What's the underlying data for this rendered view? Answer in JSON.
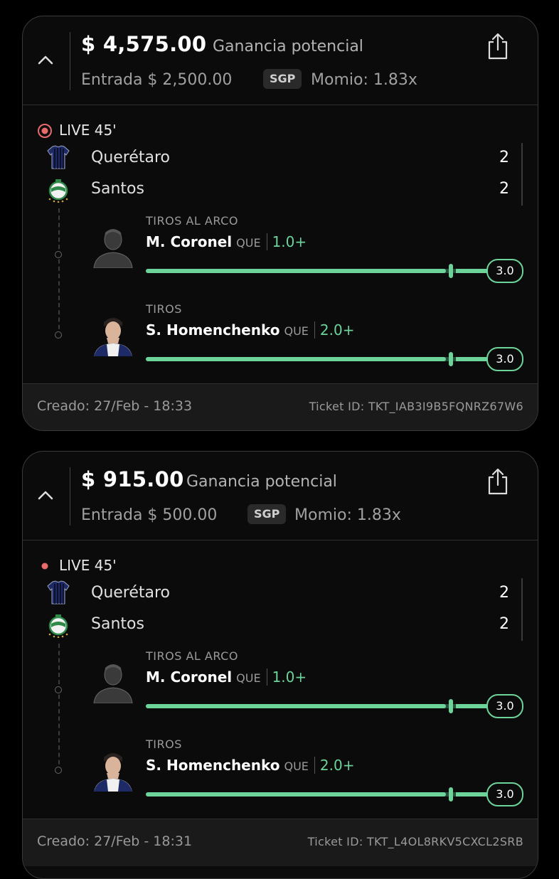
{
  "cards": [
    {
      "payout": "$ 4,575.00",
      "payout_label": "Ganancia potencial",
      "stake": "Entrada $ 2,500.00",
      "sgp": "SGP",
      "odds": "Momio: 1.83x",
      "live": "LIVE 45'",
      "teams": [
        {
          "name": "Querétaro",
          "score": "2"
        },
        {
          "name": "Santos",
          "score": "2"
        }
      ],
      "props": [
        {
          "title": "TIROS AL ARCO",
          "player": "M. Coronel",
          "team": "QUE",
          "line": "1.0+",
          "target": "3.0",
          "progress": 0.88
        },
        {
          "title": "TIROS",
          "player": "S. Homenchenko",
          "team": "QUE",
          "line": "2.0+",
          "target": "3.0",
          "progress": 0.88
        }
      ],
      "created": "Creado: 27/Feb - 18:33",
      "ticket_id": "Ticket ID: TKT_IAB3I9B5FQNRZ67W6"
    },
    {
      "payout": "$ 915.00",
      "payout_label": "Ganancia potencial",
      "stake": "Entrada $ 500.00",
      "sgp": "SGP",
      "odds": "Momio: 1.83x",
      "live": "LIVE 45'",
      "teams": [
        {
          "name": "Querétaro",
          "score": "2"
        },
        {
          "name": "Santos",
          "score": "2"
        }
      ],
      "props": [
        {
          "title": "TIROS AL ARCO",
          "player": "M. Coronel",
          "team": "QUE",
          "line": "1.0+",
          "target": "3.0",
          "progress": 0.88
        },
        {
          "title": "TIROS",
          "player": "S. Homenchenko",
          "team": "QUE",
          "line": "2.0+",
          "target": "3.0",
          "progress": 0.88
        }
      ],
      "created": "Creado: 27/Feb - 18:31",
      "ticket_id": "Ticket ID: TKT_L4OL8RKV5CXCL2SRB"
    }
  ],
  "colors": {
    "accent": "#6cd39a",
    "live": "#e86a6a"
  },
  "icons": [
    "chevron-up-icon",
    "share-icon",
    "live-indicator-icon",
    "queretaro-jersey-icon",
    "santos-crest-icon",
    "player-avatar-icon"
  ]
}
